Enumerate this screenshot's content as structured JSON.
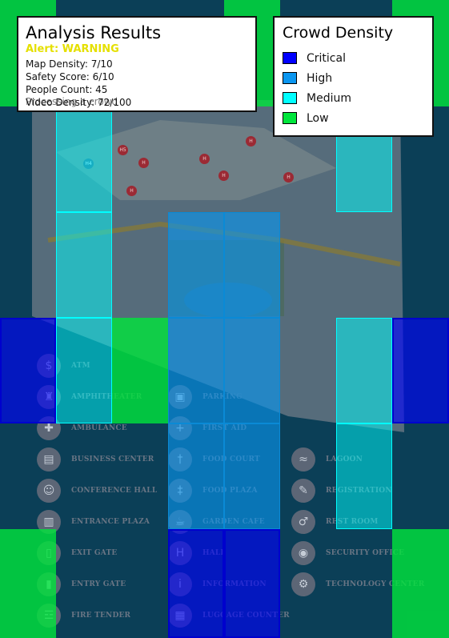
{
  "analysis": {
    "title": "Analysis Results",
    "alert": "Alert: WARNING",
    "metrics": [
      "Map Density: 7/10",
      "Safety Score: 6/10",
      "People Count: 45",
      "Video Density: 72/100"
    ],
    "overlap_text": "Processing a crowd"
  },
  "density_legend": {
    "title": "Crowd Density",
    "levels": [
      {
        "label": "Critical",
        "color": "#0000ff"
      },
      {
        "label": "High",
        "color": "#0a96f0"
      },
      {
        "label": "Medium",
        "color": "#00ffff"
      },
      {
        "label": "Low",
        "color": "#00e63c"
      }
    ]
  },
  "overlay_grid": {
    "rows": 6,
    "cols": 8,
    "cells": [
      {
        "row": 0,
        "col": 0,
        "level": "low"
      },
      {
        "row": 0,
        "col": 4,
        "level": "low"
      },
      {
        "row": 0,
        "col": 7,
        "level": "low"
      },
      {
        "row": 1,
        "col": 1,
        "level": "medium"
      },
      {
        "row": 1,
        "col": 6,
        "level": "medium"
      },
      {
        "row": 2,
        "col": 1,
        "level": "medium"
      },
      {
        "row": 2,
        "col": 3,
        "level": "high"
      },
      {
        "row": 2,
        "col": 4,
        "level": "high"
      },
      {
        "row": 3,
        "col": 0,
        "level": "critical"
      },
      {
        "row": 3,
        "col": 1,
        "level": "medium"
      },
      {
        "row": 3,
        "col": 2,
        "level": "low"
      },
      {
        "row": 3,
        "col": 3,
        "level": "high"
      },
      {
        "row": 3,
        "col": 4,
        "level": "high"
      },
      {
        "row": 3,
        "col": 6,
        "level": "medium"
      },
      {
        "row": 3,
        "col": 7,
        "level": "critical"
      },
      {
        "row": 4,
        "col": 3,
        "level": "high"
      },
      {
        "row": 4,
        "col": 4,
        "level": "high"
      },
      {
        "row": 4,
        "col": 6,
        "level": "medium"
      },
      {
        "row": 5,
        "col": 0,
        "level": "low"
      },
      {
        "row": 5,
        "col": 3,
        "level": "critical"
      },
      {
        "row": 5,
        "col": 4,
        "level": "critical"
      },
      {
        "row": 5,
        "col": 7,
        "level": "low"
      }
    ]
  },
  "map_pins": [
    {
      "label": "H5"
    },
    {
      "label": "H"
    },
    {
      "label": "H"
    },
    {
      "label": "H"
    },
    {
      "label": "H"
    },
    {
      "label": "H4"
    },
    {
      "label": "H"
    },
    {
      "label": "H"
    }
  ],
  "map_legend": {
    "col1": [
      {
        "label": "ATM",
        "icon": "atm-icon"
      },
      {
        "label": "AMPHITHEATER",
        "icon": "amphitheater-icon"
      },
      {
        "label": "AMBULANCE",
        "icon": "ambulance-icon"
      },
      {
        "label": "BUSINESS CENTER",
        "icon": "business-center-icon"
      },
      {
        "label": "CONFERENCE HALL",
        "icon": "conference-hall-icon"
      },
      {
        "label": "ENTRANCE PLAZA",
        "icon": "entrance-plaza-icon"
      },
      {
        "label": "EXIT GATE",
        "icon": "exit-gate-icon"
      },
      {
        "label": "ENTRY GATE",
        "icon": "entry-gate-icon"
      },
      {
        "label": "FIRE TENDER",
        "icon": "fire-tender-icon"
      }
    ],
    "col2": [
      {
        "label": "PARKING",
        "icon": "parking-icon"
      },
      {
        "label": "FIRST AID",
        "icon": "first-aid-icon"
      },
      {
        "label": "FOOD COURT",
        "icon": "food-court-icon"
      },
      {
        "label": "FOOD PLAZA",
        "icon": "food-plaza-icon"
      },
      {
        "label": "GARDEN CAFE",
        "icon": "garden-cafe-icon"
      },
      {
        "label": "HALL",
        "icon": "hall-icon"
      },
      {
        "label": "INFORMATION",
        "icon": "information-icon"
      },
      {
        "label": "LUGGAGE COUNTER",
        "icon": "luggage-counter-icon"
      }
    ],
    "col3": [
      {
        "label": "LAGOON",
        "icon": "lagoon-icon"
      },
      {
        "label": "REGISTRATION",
        "icon": "registration-icon"
      },
      {
        "label": "REST ROOM",
        "icon": "rest-room-icon"
      },
      {
        "label": "SECURITY OFFICE",
        "icon": "security-office-icon"
      },
      {
        "label": "TECHNOLOGY CENTER",
        "icon": "technology-center-icon"
      }
    ]
  }
}
